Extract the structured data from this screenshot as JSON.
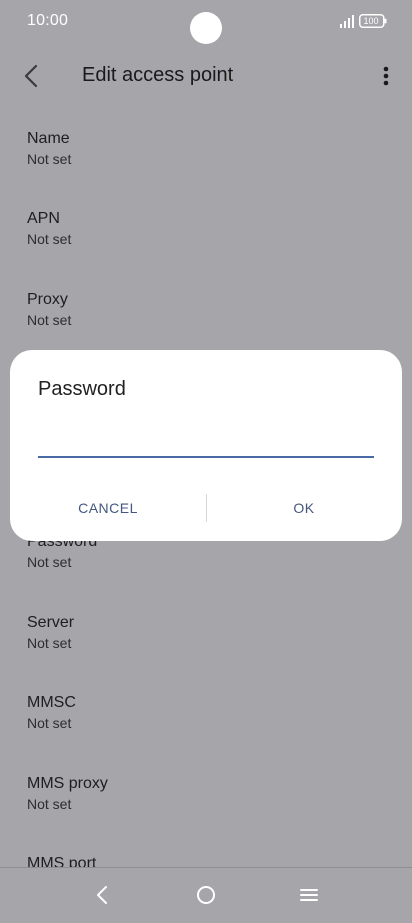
{
  "status_bar": {
    "time": "10:00",
    "battery": "100"
  },
  "app_bar": {
    "title": "Edit access point"
  },
  "items": [
    {
      "title": "Name",
      "value": "Not set"
    },
    {
      "title": "APN",
      "value": "Not set"
    },
    {
      "title": "Proxy",
      "value": "Not set"
    },
    {
      "title": "Password",
      "value": "Not set"
    },
    {
      "title": "Server",
      "value": "Not set"
    },
    {
      "title": "MMSC",
      "value": "Not set"
    },
    {
      "title": "MMS proxy",
      "value": "Not set"
    },
    {
      "title": "MMS port",
      "value": ""
    }
  ],
  "dialog": {
    "title": "Password",
    "input_value": "",
    "cancel_label": "CANCEL",
    "ok_label": "OK"
  },
  "colors": {
    "scrim_background": "#a6a5aa",
    "accent": "#4a6aa5",
    "button_text": "#44577f"
  }
}
